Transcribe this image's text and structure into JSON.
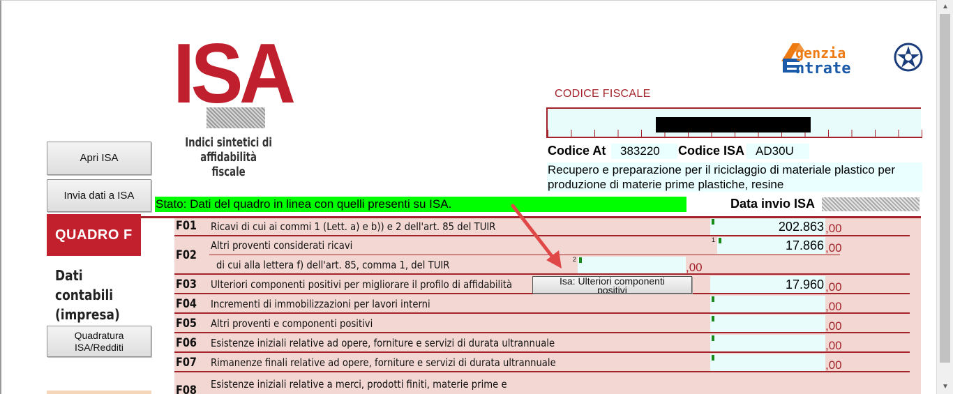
{
  "logo": {
    "brand": "ISA",
    "subtitle_line1": "Indici sintetici di",
    "subtitle_line2": "affidabilità fiscale"
  },
  "agenzia": {
    "line1": "genzia",
    "line2": "ntrate"
  },
  "buttons": {
    "apri": "Apri ISA",
    "invia": "Invia dati a ISA",
    "quadratura_line1": "Quadratura",
    "quadratura_line2": "ISA/Redditi"
  },
  "status": "Stato: Dati del quadro in linea con quelli presenti su ISA.",
  "header": {
    "codice_fiscale_label": "CODICE FISCALE",
    "codice_attivita_label": "Codice At",
    "codice_attivita_value": "383220",
    "codice_isa_label": "Codice ISA",
    "codice_isa_value": "AD30U",
    "descrizione": "Recupero e preparazione per il riciclaggio di materiale plastico per produzione di materie prime plastiche, resine",
    "data_invio_label": "Data invio ISA"
  },
  "quadro": {
    "label": "QUADRO F",
    "title_line1": "Dati",
    "title_line2": "contabili",
    "title_line3": "(impresa)"
  },
  "rows": [
    {
      "code": "F01",
      "desc": "Ricavi di cui ai commi 1 (Lett. a) e b)) e 2 dell'art. 85 del TUIR",
      "value": "202.863",
      "dec": ",00"
    },
    {
      "code": "F02",
      "desc": "Altri proventi considerati ricavi",
      "sup": "1",
      "value": "17.866",
      "dec": ",00"
    },
    {
      "code": "",
      "desc": "di cui alla lettera f) dell'art. 85, comma 1, del TUIR",
      "sup": "2",
      "value": "",
      "dec": ",00"
    },
    {
      "code": "F03",
      "desc": "Ulteriori componenti positivi per migliorare il profilo di affidabilità",
      "value": "17.960",
      "dec": ",00"
    },
    {
      "code": "F04",
      "desc": "Incrementi di immobilizzazioni per lavori interni",
      "value": "",
      "dec": ",00"
    },
    {
      "code": "F05",
      "desc": "Altri proventi e componenti positivi",
      "value": "",
      "dec": ",00"
    },
    {
      "code": "F06",
      "desc": "Esistenze iniziali relative ad opere, forniture e servizi di durata ultrannuale",
      "value": "",
      "dec": ",00"
    },
    {
      "code": "F07",
      "desc": "Rimanenze finali relative ad opere, forniture e servizi di durata ultrannuale",
      "value": "",
      "dec": ",00"
    },
    {
      "code": "F08",
      "desc": "Esistenze iniziali relative a merci, prodotti finiti, materie prime e",
      "value": "",
      "dec": ""
    }
  ],
  "isa_button": {
    "line1": "Isa: Ulteriori componenti",
    "line2": "positivi"
  },
  "colors": {
    "brand_red": "#c2202d",
    "status_green": "#00ff00",
    "table_bg": "#f2d7d2",
    "field_bg": "#e8fcfc"
  }
}
